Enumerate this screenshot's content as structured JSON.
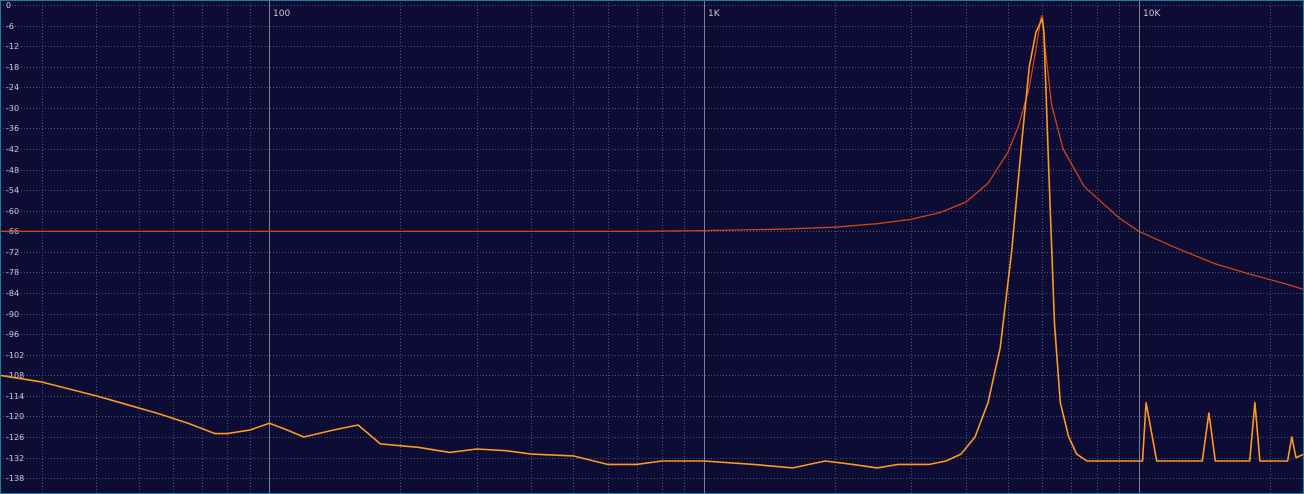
{
  "chart_data": {
    "type": "line",
    "title": "",
    "xlabel": "",
    "ylabel": "",
    "xscale": "log",
    "xlim": [
      24,
      24000
    ],
    "ylim": [
      -140,
      0
    ],
    "grid": true,
    "legend": "none",
    "colors": {
      "background": "#0c0c34",
      "grid_major": "#7a7e99",
      "grid_minor": "#4e5274",
      "frame": "#1d7fa0",
      "label_text": "#c7c9d6",
      "series_filter": "#d0421a",
      "series_spectrum": "#ff9a1f"
    },
    "x_ticks": [
      {
        "value": 100,
        "label": "100"
      },
      {
        "value": 1000,
        "label": "1K"
      },
      {
        "value": 10000,
        "label": "10K"
      }
    ],
    "y_ticks": [
      {
        "value": 0,
        "label": "0"
      },
      {
        "value": -6,
        "label": "-6"
      },
      {
        "value": -12,
        "label": "-12"
      },
      {
        "value": -18,
        "label": "-18"
      },
      {
        "value": -24,
        "label": "-24"
      },
      {
        "value": -30,
        "label": "-30"
      },
      {
        "value": -36,
        "label": "-36"
      },
      {
        "value": -42,
        "label": "-42"
      },
      {
        "value": -48,
        "label": "-48"
      },
      {
        "value": -54,
        "label": "-54"
      },
      {
        "value": -60,
        "label": "-60"
      },
      {
        "value": -66,
        "label": "-66"
      },
      {
        "value": -72,
        "label": "-72"
      },
      {
        "value": -78,
        "label": "-78"
      },
      {
        "value": -84,
        "label": "-84"
      },
      {
        "value": -90,
        "label": "-90"
      },
      {
        "value": -96,
        "label": "-96"
      },
      {
        "value": -102,
        "label": "-102"
      },
      {
        "value": -108,
        "label": "-108"
      },
      {
        "value": -114,
        "label": "-114"
      },
      {
        "value": -120,
        "label": "-120"
      },
      {
        "value": -126,
        "label": "-126"
      },
      {
        "value": -132,
        "label": "-132"
      },
      {
        "value": -138,
        "label": "-138"
      }
    ],
    "series": [
      {
        "color": "#d0421a",
        "x": [
          24,
          100,
          300,
          700,
          1000,
          1500,
          2000,
          2500,
          3000,
          3500,
          4000,
          4500,
          5000,
          5300,
          5600,
          5800,
          5950,
          6000,
          6100,
          6300,
          6700,
          7500,
          9000,
          10000,
          12000,
          15000,
          18000,
          22000,
          24000
        ],
        "y": [
          -66,
          -66,
          -66,
          -66,
          -65.8,
          -65.4,
          -64.8,
          -63.8,
          -62.5,
          -60.5,
          -57.5,
          -52,
          -43,
          -35,
          -24,
          -13,
          -4,
          -3,
          -13,
          -29,
          -42,
          -53,
          -62,
          -66,
          -70.5,
          -75.5,
          -78.5,
          -81.5,
          -83
        ]
      },
      {
        "color": "#ff9a1f",
        "x": [
          24,
          30,
          40,
          55,
          65,
          75,
          80,
          90,
          100,
          110,
          120,
          140,
          160,
          180,
          220,
          260,
          300,
          350,
          400,
          500,
          600,
          700,
          800,
          1000,
          1300,
          1600,
          1900,
          2200,
          2500,
          2800,
          3000,
          3300,
          3600,
          3900,
          4200,
          4500,
          4800,
          5100,
          5400,
          5600,
          5800,
          5950,
          6000,
          6050,
          6200,
          6400,
          6600,
          6900,
          7200,
          7600,
          8000,
          8800,
          9800,
          10200,
          10400,
          11000,
          12000,
          13000,
          14000,
          14500,
          15000,
          16000,
          17000,
          18000,
          18500,
          19000,
          20000,
          21000,
          22000,
          22500,
          23000,
          24000
        ],
        "y": [
          -108,
          -110,
          -114,
          -119,
          -122,
          -125,
          -125,
          -124,
          -122,
          -124,
          -126,
          -124,
          -122.5,
          -128,
          -129,
          -130.5,
          -129.5,
          -130,
          -131,
          -131.5,
          -134,
          -134,
          -133,
          -133,
          -134,
          -135,
          -133,
          -134,
          -135,
          -134,
          -134,
          -134,
          -133,
          -131,
          -126,
          -116,
          -100,
          -72,
          -38,
          -18,
          -8,
          -5,
          -4,
          -8,
          -46,
          -93,
          -116,
          -126,
          -131,
          -133,
          -133,
          -133,
          -133,
          -133,
          -116,
          -133,
          -133,
          -133,
          -133,
          -119,
          -133,
          -133,
          -133,
          -133,
          -116,
          -133,
          -133,
          -133,
          -133,
          -126,
          -132,
          -131
        ]
      }
    ]
  }
}
